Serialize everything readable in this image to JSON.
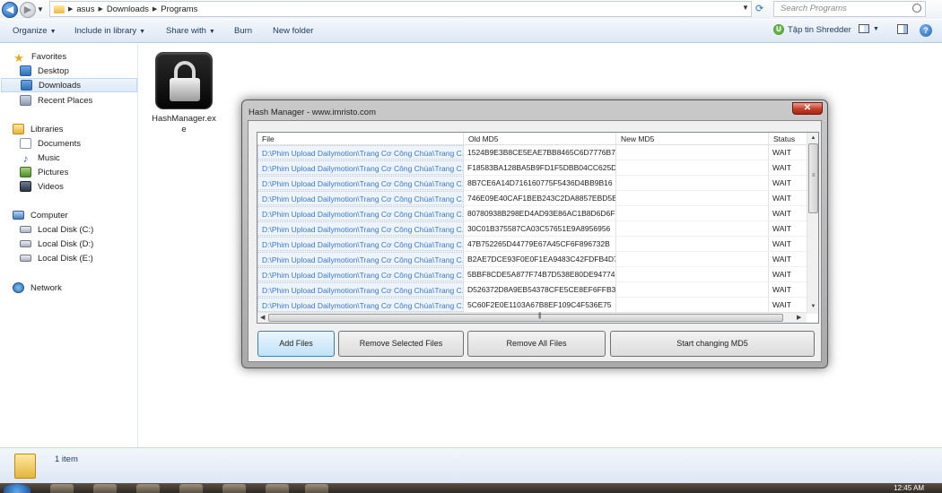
{
  "addressbar": {
    "crumbs": [
      "asus",
      "Downloads",
      "Programs"
    ],
    "search_placeholder": "Search Programs"
  },
  "toolbar": {
    "organize": "Organize",
    "include_in_library": "Include in library",
    "share_with": "Share with",
    "burn": "Burn",
    "new_folder": "New folder",
    "shredder": "Tập tin Shredder"
  },
  "nav": {
    "favorites": "Favorites",
    "desktop": "Desktop",
    "downloads": "Downloads",
    "recent_places": "Recent Places",
    "libraries": "Libraries",
    "documents": "Documents",
    "music": "Music",
    "pictures": "Pictures",
    "videos": "Videos",
    "computer": "Computer",
    "disk_c": "Local Disk (C:)",
    "disk_d": "Local Disk (D:)",
    "disk_e": "Local Disk (E:)",
    "network": "Network"
  },
  "content": {
    "file_name": "HashManager.exe"
  },
  "statusbar": {
    "count": "1 item"
  },
  "taskbar": {
    "clock": "12:45 AM"
  },
  "dialog": {
    "title": "Hash Manager - www.imristo.com",
    "close": "✕",
    "columns": [
      "File",
      "Old MD5",
      "New MD5",
      "Status"
    ],
    "rows": [
      {
        "file": "D:\\Phim Upload Dailymotion\\Trang Cơ Công Chúa\\Trang C...",
        "old": "1524B9E3B8CE5EAE7BB8465C6D7776B7",
        "new": "",
        "status": "WAIT"
      },
      {
        "file": "D:\\Phim Upload Dailymotion\\Trang Cơ Công Chúa\\Trang C...",
        "old": "F18583BA128BA5B9FD1F5DBB04CC625D",
        "new": "",
        "status": "WAIT"
      },
      {
        "file": "D:\\Phim Upload Dailymotion\\Trang Cơ Công Chúa\\Trang C...",
        "old": "8B7CE6A14D716160775F5436D4BB9B16",
        "new": "",
        "status": "WAIT"
      },
      {
        "file": "D:\\Phim Upload Dailymotion\\Trang Cơ Công Chúa\\Trang C...",
        "old": "746E09E40CAF1BEB243C2DA8857EBD5B",
        "new": "",
        "status": "WAIT"
      },
      {
        "file": "D:\\Phim Upload Dailymotion\\Trang Cơ Công Chúa\\Trang C...",
        "old": "80780938B298ED4AD93E86AC1B8D6D6F",
        "new": "",
        "status": "WAIT"
      },
      {
        "file": "D:\\Phim Upload Dailymotion\\Trang Cơ Công Chúa\\Trang C...",
        "old": "30C01B375587CA03C57651E9A8956956",
        "new": "",
        "status": "WAIT"
      },
      {
        "file": "D:\\Phim Upload Dailymotion\\Trang Cơ Công Chúa\\Trang C...",
        "old": "47B752265D44779E67A45CF6F896732B",
        "new": "",
        "status": "WAIT"
      },
      {
        "file": "D:\\Phim Upload Dailymotion\\Trang Cơ Công Chúa\\Trang C...",
        "old": "B2AE7DCE93F0E0F1EA9483C42FDFB4D7",
        "new": "",
        "status": "WAIT"
      },
      {
        "file": "D:\\Phim Upload Dailymotion\\Trang Cơ Công Chúa\\Trang C...",
        "old": "5BBF8CDE5A877F74B7D538E80DE94774",
        "new": "",
        "status": "WAIT"
      },
      {
        "file": "D:\\Phim Upload Dailymotion\\Trang Cơ Công Chúa\\Trang C...",
        "old": "D526372D8A9EB54378CFE5CE8EF6FFB3",
        "new": "",
        "status": "WAIT"
      },
      {
        "file": "D:\\Phim Upload Dailymotion\\Trang Cơ Công Chúa\\Trang C...",
        "old": "5C60F2E0E1103A67B8EF109C4F536E75",
        "new": "",
        "status": "WAIT"
      }
    ],
    "buttons": {
      "add_files": "Add Files",
      "remove_selected": "Remove Selected Files",
      "remove_all": "Remove All Files",
      "start_changing": "Start changing MD5"
    }
  }
}
